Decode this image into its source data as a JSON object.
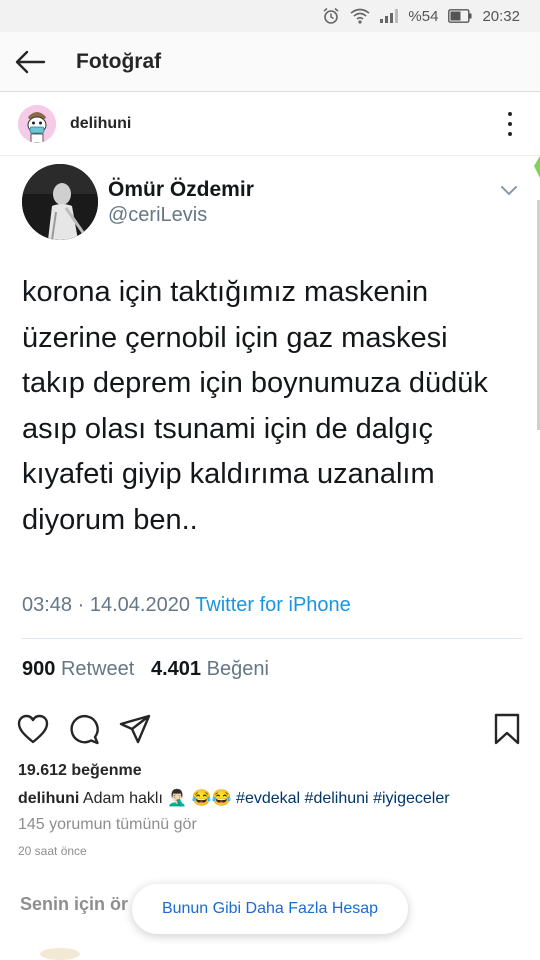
{
  "status_bar": {
    "battery_percent": "%54",
    "time": "20:32",
    "icons": [
      "alarm-icon",
      "wifi-icon",
      "signal-icon",
      "battery-icon"
    ]
  },
  "header": {
    "title": "Fotoğraf",
    "back_icon": "back-arrow-icon"
  },
  "post": {
    "username": "delihuni",
    "more_icon": "more-vertical-icon"
  },
  "tweet": {
    "name": "Ömür Özdemir",
    "handle": "@ceriLevis",
    "text_lines": [
      "korona için taktığımız maskenin",
      "üzerine çernobil için gaz maskesi",
      "takıp deprem için boynumuza düdük",
      "asıp olası tsunami için de dalgıç",
      "kıyafeti giyip kaldırıma uzanalım",
      "diyorum ben.."
    ],
    "time": "03:48",
    "separator": "·",
    "date": "14.04.2020",
    "source": "Twitter for iPhone",
    "retweets": "900",
    "retweets_label": "Retweet",
    "likes": "4.401",
    "likes_label": "Beğeni"
  },
  "actions": {
    "icons": [
      "heart-icon",
      "comment-icon",
      "share-icon",
      "bookmark-icon"
    ]
  },
  "engagement": {
    "likes_text": "19.612 beğenme",
    "caption_user": "delihuni",
    "caption_text": "Adam haklı 🤦🏻‍♂️ 😂😂",
    "hashtags": [
      "#evdekal",
      "#delihuni",
      "#iyigeceler"
    ],
    "comments_link": "145 yorumun tümünü gör",
    "time_ago": "20 saat önce"
  },
  "suggestions": {
    "label": "Senin için ör",
    "toast": "Bunun Gibi Daha Fazla Hesap"
  },
  "colors": {
    "link_blue": "#1b95e0",
    "hashtag": "#003569",
    "muted": "#8e8e8e",
    "toast_text": "#1a6bd6"
  }
}
